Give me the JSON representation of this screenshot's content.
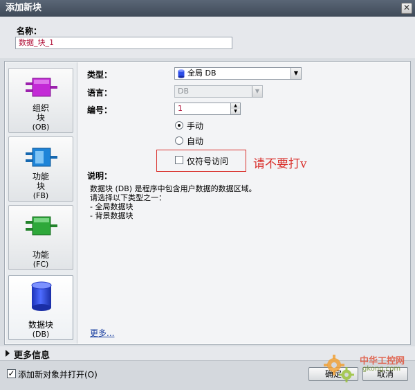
{
  "window": {
    "title": "添加新块",
    "close_glyph": "✕"
  },
  "name": {
    "label": "名称：",
    "value": "数据_块_1"
  },
  "block_types": [
    {
      "lines": [
        "组织",
        "块"
      ],
      "code": "(OB)",
      "color": "#c32ad6"
    },
    {
      "lines": [
        "功能",
        "块"
      ],
      "code": "(FB)",
      "color": "#1e84d8"
    },
    {
      "lines": [
        "功能"
      ],
      "code": "(FC)",
      "color": "#2ea83a"
    },
    {
      "lines": [
        "数据块"
      ],
      "code": "(DB)",
      "color": "#2d4ee8"
    }
  ],
  "fields": {
    "type_label": "类型：",
    "type_value": "全局 DB",
    "language_label": "语言：",
    "language_value": "DB",
    "number_label": "编号：",
    "number_value": "1",
    "manual_label": "手动",
    "auto_label": "自动",
    "symbolic_label": "仅符号访问"
  },
  "annotation": "请不要打v",
  "description": {
    "label": "说明：",
    "lines": [
      "数据块 (DB) 是程序中包含用户数据的数据区域。",
      "请选择以下类型之一：",
      "- 全局数据块",
      "- 背景数据块"
    ]
  },
  "more_link": "更多...",
  "more_info": "更多信息",
  "bottom": {
    "add_open_label": "添加新对象并打开(O)",
    "ok_label": "确定",
    "cancel_label": "取消"
  },
  "watermark": {
    "title": "中华工控网",
    "url": "gkong.com"
  }
}
